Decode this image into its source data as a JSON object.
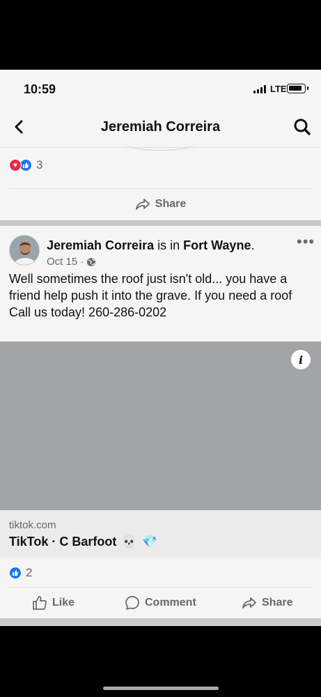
{
  "status_bar": {
    "time": "10:59",
    "network": "LTE"
  },
  "nav": {
    "title": "Jeremiah Correira",
    "back_icon": "chevron-left-icon",
    "search_icon": "search-icon"
  },
  "previous_post": {
    "reaction_count": "3",
    "share_label": "Share"
  },
  "post": {
    "author": "Jeremiah Correira",
    "is_in": " is in ",
    "location": "Fort Wayne",
    "period": ".",
    "date": "Oct 15",
    "date_separator": "·",
    "privacy_icon": "globe-icon",
    "text": "Well sometimes the roof just isn't old... you have a friend help push it into the grave. If you need a roof Call us today! 260-286-0202",
    "link": {
      "domain": "tiktok.com",
      "title": "TikTok · C Barfoot",
      "emoji_1": "💀",
      "emoji_2": "💎"
    },
    "like_count": "2",
    "actions": {
      "like": "Like",
      "comment": "Comment",
      "share": "Share"
    },
    "info_label": "i",
    "more_label": "•••"
  },
  "colors": {
    "brand_blue": "#1877f2",
    "love_red": "#f02849",
    "muted_text": "#65676b"
  }
}
